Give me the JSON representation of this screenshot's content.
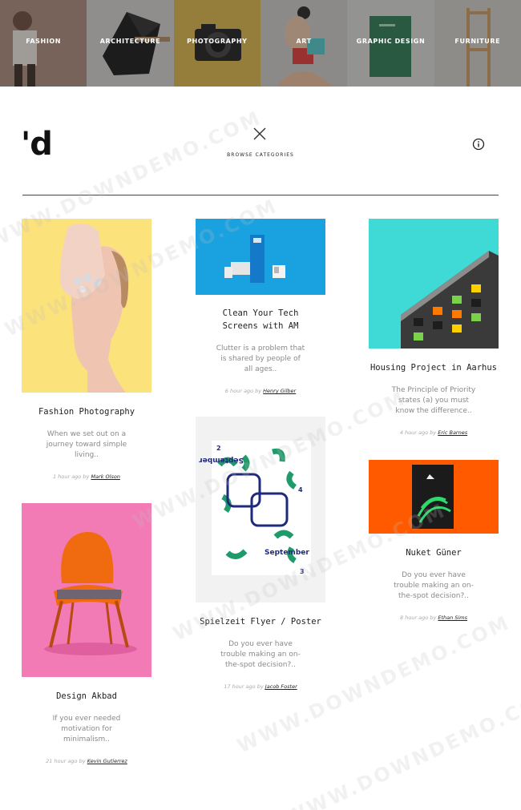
{
  "categories": [
    {
      "label": "FASHION",
      "bg": "#b89a8c"
    },
    {
      "label": "ARCHITECTURE",
      "bg": "#d8d6d4"
    },
    {
      "label": "PHOTOGRAPHY",
      "bg": "#d8b24a"
    },
    {
      "label": "ART",
      "bg": "#c9c7c4"
    },
    {
      "label": "GRAPHIC DESIGN",
      "bg": "#d6d6d4"
    },
    {
      "label": "FURNITURE",
      "bg": "#cdcac6"
    }
  ],
  "header": {
    "logo": "'d",
    "browse_label": "BROWSE CATEGORIES"
  },
  "cards": {
    "fashion": {
      "title": "Fashion Photography",
      "desc": "When we set out on a journey toward simple living..",
      "time": "1 hour ago",
      "by": "by",
      "author": "Mark Olson",
      "bg": "#fce27a"
    },
    "clean": {
      "title": "Clean Your Tech Screens with AM",
      "desc": "Clutter is a problem that is shared by people of all ages..",
      "time": "6 hour ago",
      "by": "by",
      "author": "Henry Gilber",
      "bg": "#1aa2e0"
    },
    "housing": {
      "title": "Housing Project in Aarhus",
      "desc": "The Principle of Priority states (a) you must know the difference..",
      "time": "4 hour ago",
      "by": "by",
      "author": "Eric Barnes",
      "bg": "#3fd9d6"
    },
    "spielzeit": {
      "title": "Spielzeit Flyer / Poster",
      "desc": "Do you ever have trouble making an on-the-spot decision?..",
      "time": "17 hour ago",
      "by": "by",
      "author": "Jacob Foster",
      "bg": "#f2f2f2"
    },
    "nuket": {
      "title": "Nuket Güner",
      "desc": "Do you ever have trouble making an on-the-spot decision?..",
      "time": "8 hour ago",
      "by": "by",
      "author": "Ethan Sims",
      "bg": "#ff5a00"
    },
    "design": {
      "title": "Design Akbad",
      "desc": "If you ever needed motivation for minimalism..",
      "time": "21 hour ago",
      "by": "by",
      "author": "Kevin Gutierrez",
      "bg": "#f27bb5"
    }
  },
  "poster": {
    "month_top": "September",
    "month_bottom": "September",
    "num_a": "2",
    "num_b": "3",
    "num_c": "4"
  },
  "watermark": "WWW.DOWNDEMO.COM"
}
